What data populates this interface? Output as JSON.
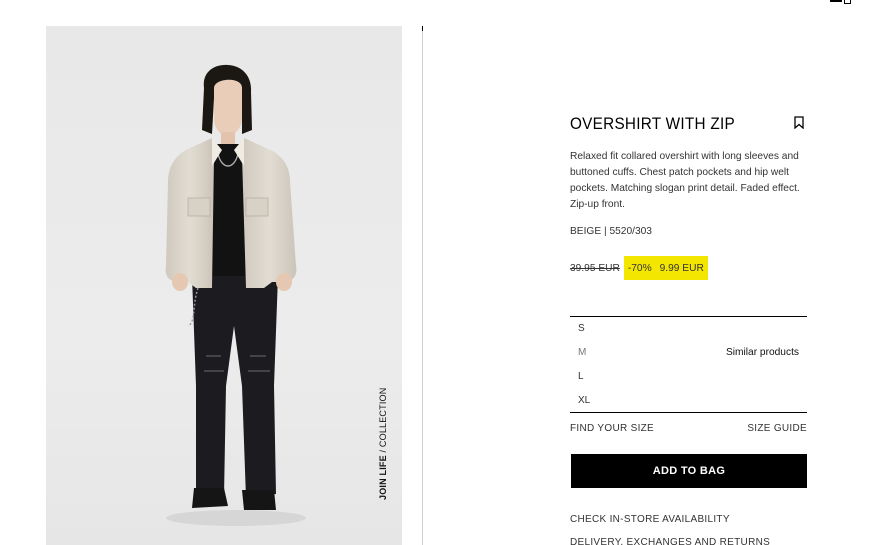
{
  "header": {
    "icon": "menu-bookmark-icon"
  },
  "image": {
    "caption_bold": "JOIN LIFE",
    "caption_rest": " / COLLECTION"
  },
  "product": {
    "title": "OVERSHIRT WITH ZIP",
    "description": "Relaxed fit collared overshirt with long sleeves and buttoned cuffs. Chest patch pockets and hip welt pockets. Matching slogan print detail. Faded effect. Zip-up front.",
    "color_ref": "BEIGE | 5520/303",
    "old_price": "39.95 EUR",
    "discount": "-70%",
    "price": "9.99 EUR",
    "sale_color": "#f3e600"
  },
  "sizes": {
    "options": [
      "S",
      "M",
      "L",
      "XL"
    ],
    "similar_label": "Similar products"
  },
  "actions": {
    "find_size": "FIND YOUR SIZE",
    "size_guide": "SIZE GUIDE",
    "add_to_bag": "ADD TO BAG",
    "check_store": "CHECK IN-STORE AVAILABILITY",
    "delivery": "DELIVERY, EXCHANGES AND RETURNS"
  }
}
